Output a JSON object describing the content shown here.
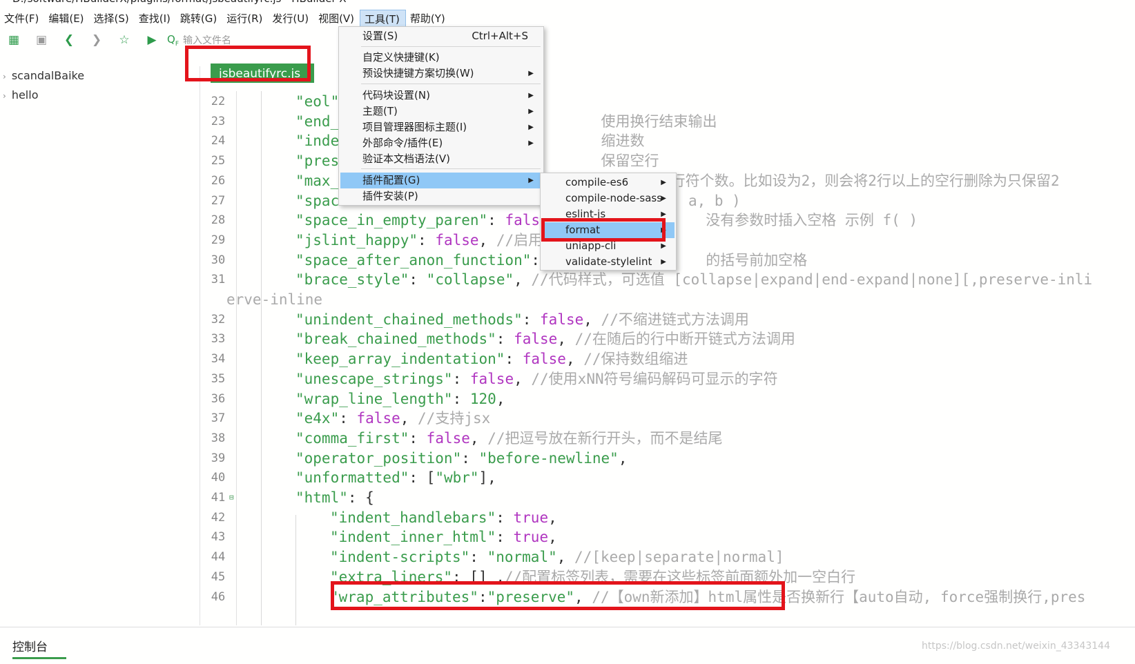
{
  "window": {
    "title": "D:/software/HBuilderX/plugins/format/jsbeautifyrc.js - HBuilder X"
  },
  "menubar": [
    "文件(F)",
    "编辑(E)",
    "选择(S)",
    "查找(I)",
    "跳转(G)",
    "运行(R)",
    "发行(U)",
    "视图(V)",
    "工具(T)",
    "帮助(Y)"
  ],
  "toolbar": {
    "icons": [
      "new-file-icon",
      "save-icon",
      "back-icon",
      "forward-icon",
      "star-icon",
      "run-icon"
    ],
    "search_placeholder": "输入文件名"
  },
  "sidebar": {
    "projects": [
      "scandalBaike",
      "hello"
    ]
  },
  "tab": {
    "label": "jsbeautifyrc.js"
  },
  "tools_menu": {
    "items": [
      {
        "label": "设置(S)",
        "shortcut": "Ctrl+Alt+S"
      },
      {
        "label": "自定义快捷键(K)"
      },
      {
        "label": "预设快捷键方案切换(W)",
        "submenu": true
      },
      {
        "label": "代码块设置(N)",
        "submenu": true
      },
      {
        "label": "主题(T)",
        "submenu": true
      },
      {
        "label": "项目管理器图标主题(I)",
        "submenu": true
      },
      {
        "label": "外部命令/插件(E)",
        "submenu": true
      },
      {
        "label": "验证本文档语法(V)"
      },
      {
        "label": "插件配置(G)",
        "submenu": true,
        "highlighted": true
      },
      {
        "label": "插件安装(P)"
      }
    ]
  },
  "plugin_submenu": {
    "items": [
      {
        "label": "compile-es6"
      },
      {
        "label": "compile-node-sass"
      },
      {
        "label": "eslint-js"
      },
      {
        "label": "format",
        "highlighted": true
      },
      {
        "label": "uniapp-cli"
      },
      {
        "label": "validate-stylelint"
      }
    ]
  },
  "editor": {
    "lines": [
      {
        "n": "22",
        "t": [
          [
            "s",
            "\"eol\""
          ]
        ]
      },
      {
        "n": "23",
        "t": [
          [
            "s",
            "\"end_"
          ],
          [
            "c",
            "                              使用换行结束输出"
          ]
        ]
      },
      {
        "n": "24",
        "t": [
          [
            "s",
            "\"inde"
          ],
          [
            "c",
            "                              缩进数"
          ]
        ]
      },
      {
        "n": "25",
        "t": [
          [
            "s",
            "\"pres"
          ],
          [
            "c",
            "                              保留空行"
          ]
        ]
      },
      {
        "n": "26",
        "t": [
          [
            "s",
            "\"max_"
          ],
          [
            "c",
            "                                      行符个数。比如设为2，则会将2行以上的空行删除为只保留2"
          ]
        ]
      },
      {
        "n": "27",
        "t": [
          [
            "s",
            "\"spac"
          ],
          [
            "c",
            "                                        a, b )"
          ]
        ]
      },
      {
        "n": "28",
        "t": [
          [
            "s",
            "\"space_in_empty_paren\""
          ],
          [
            "p",
            ": "
          ],
          [
            "k",
            "false"
          ],
          [
            "c",
            "                  没有参数时插入空格 示例 f( )"
          ]
        ]
      },
      {
        "n": "29",
        "t": [
          [
            "s",
            "\"jslint_happy\""
          ],
          [
            "p",
            ": "
          ],
          [
            "k",
            "false"
          ],
          [
            "p",
            ", "
          ],
          [
            "c",
            "//启用"
          ]
        ]
      },
      {
        "n": "30",
        "t": [
          [
            "s",
            "\"space_after_anon_function\""
          ],
          [
            "p",
            ": "
          ],
          [
            "c",
            "                  的括号前加空格"
          ]
        ]
      },
      {
        "n": "31",
        "t": [
          [
            "s",
            "\"brace_style\""
          ],
          [
            "p",
            ": "
          ],
          [
            "n",
            "\"collapse\""
          ],
          [
            "p",
            ", "
          ],
          [
            "c",
            "//代码样式，可选值 [collapse|expand|end-expand|none][,preserve-inli"
          ]
        ]
      },
      {
        "n": "",
        "wrap": true,
        "t": [
          [
            "c",
            "erve-inline"
          ]
        ]
      },
      {
        "n": "32",
        "t": [
          [
            "s",
            "\"unindent_chained_methods\""
          ],
          [
            "p",
            ": "
          ],
          [
            "k",
            "false"
          ],
          [
            "p",
            ", "
          ],
          [
            "c",
            "//不缩进链式方法调用"
          ]
        ]
      },
      {
        "n": "33",
        "t": [
          [
            "s",
            "\"break_chained_methods\""
          ],
          [
            "p",
            ": "
          ],
          [
            "k",
            "false"
          ],
          [
            "p",
            ", "
          ],
          [
            "c",
            "//在随后的行中断开链式方法调用"
          ]
        ]
      },
      {
        "n": "34",
        "t": [
          [
            "s",
            "\"keep_array_indentation\""
          ],
          [
            "p",
            ": "
          ],
          [
            "k",
            "false"
          ],
          [
            "p",
            ", "
          ],
          [
            "c",
            "//保持数组缩进"
          ]
        ]
      },
      {
        "n": "35",
        "t": [
          [
            "s",
            "\"unescape_strings\""
          ],
          [
            "p",
            ": "
          ],
          [
            "k",
            "false"
          ],
          [
            "p",
            ", "
          ],
          [
            "c",
            "//使用xNN符号编码解码可显示的字符"
          ]
        ]
      },
      {
        "n": "36",
        "t": [
          [
            "s",
            "\"wrap_line_length\""
          ],
          [
            "p",
            ": "
          ],
          [
            "n",
            "120"
          ],
          [
            "p",
            ","
          ]
        ]
      },
      {
        "n": "37",
        "t": [
          [
            "s",
            "\"e4x\""
          ],
          [
            "p",
            ": "
          ],
          [
            "k",
            "false"
          ],
          [
            "p",
            ", "
          ],
          [
            "c",
            "//支持jsx"
          ]
        ]
      },
      {
        "n": "38",
        "t": [
          [
            "s",
            "\"comma_first\""
          ],
          [
            "p",
            ": "
          ],
          [
            "k",
            "false"
          ],
          [
            "p",
            ", "
          ],
          [
            "c",
            "//把逗号放在新行开头，而不是结尾"
          ]
        ]
      },
      {
        "n": "39",
        "t": [
          [
            "s",
            "\"operator_position\""
          ],
          [
            "p",
            ": "
          ],
          [
            "n",
            "\"before-newline\""
          ],
          [
            "p",
            ","
          ]
        ]
      },
      {
        "n": "40",
        "t": [
          [
            "s",
            "\"unformatted\""
          ],
          [
            "p",
            ": ["
          ],
          [
            "n",
            "\"wbr\""
          ],
          [
            "p",
            "],"
          ]
        ]
      },
      {
        "n": "41",
        "fold": true,
        "t": [
          [
            "s",
            "\"html\""
          ],
          [
            "p",
            ": {"
          ]
        ]
      },
      {
        "n": "42",
        "indent": 2,
        "t": [
          [
            "s",
            "\"indent_handlebars\""
          ],
          [
            "p",
            ": "
          ],
          [
            "k",
            "true"
          ],
          [
            "p",
            ","
          ]
        ]
      },
      {
        "n": "43",
        "indent": 2,
        "t": [
          [
            "s",
            "\"indent_inner_html\""
          ],
          [
            "p",
            ": "
          ],
          [
            "k",
            "true"
          ],
          [
            "p",
            ","
          ]
        ]
      },
      {
        "n": "44",
        "indent": 2,
        "t": [
          [
            "s",
            "\"indent-scripts\""
          ],
          [
            "p",
            ": "
          ],
          [
            "n",
            "\"normal\""
          ],
          [
            "p",
            ", "
          ],
          [
            "c",
            "//[keep|separate|normal]"
          ]
        ]
      },
      {
        "n": "45",
        "indent": 2,
        "t": [
          [
            "s",
            "\"extra_liners\""
          ],
          [
            "p",
            ": [] ,"
          ],
          [
            "c",
            "//配置标签列表，需要在这些标签前面额外加一空白行"
          ]
        ]
      },
      {
        "n": "46",
        "indent": 2,
        "t": [
          [
            "s",
            "\"wrap_attributes\""
          ],
          [
            "p",
            ":"
          ],
          [
            "n",
            "\"preserve\""
          ],
          [
            "p",
            ", "
          ],
          [
            "c",
            "//【own新添加】html属性是否换新行【auto自动, force强制换行,pres"
          ]
        ]
      }
    ]
  },
  "console": {
    "tab": "控制台"
  },
  "watermark": "https://blog.csdn.net/weixin_43343144",
  "colors": {
    "accent": "#3a9c4c",
    "keyword": "#b035c0",
    "highlight": "#90c8f6",
    "annotation_box": "#e3141b"
  }
}
